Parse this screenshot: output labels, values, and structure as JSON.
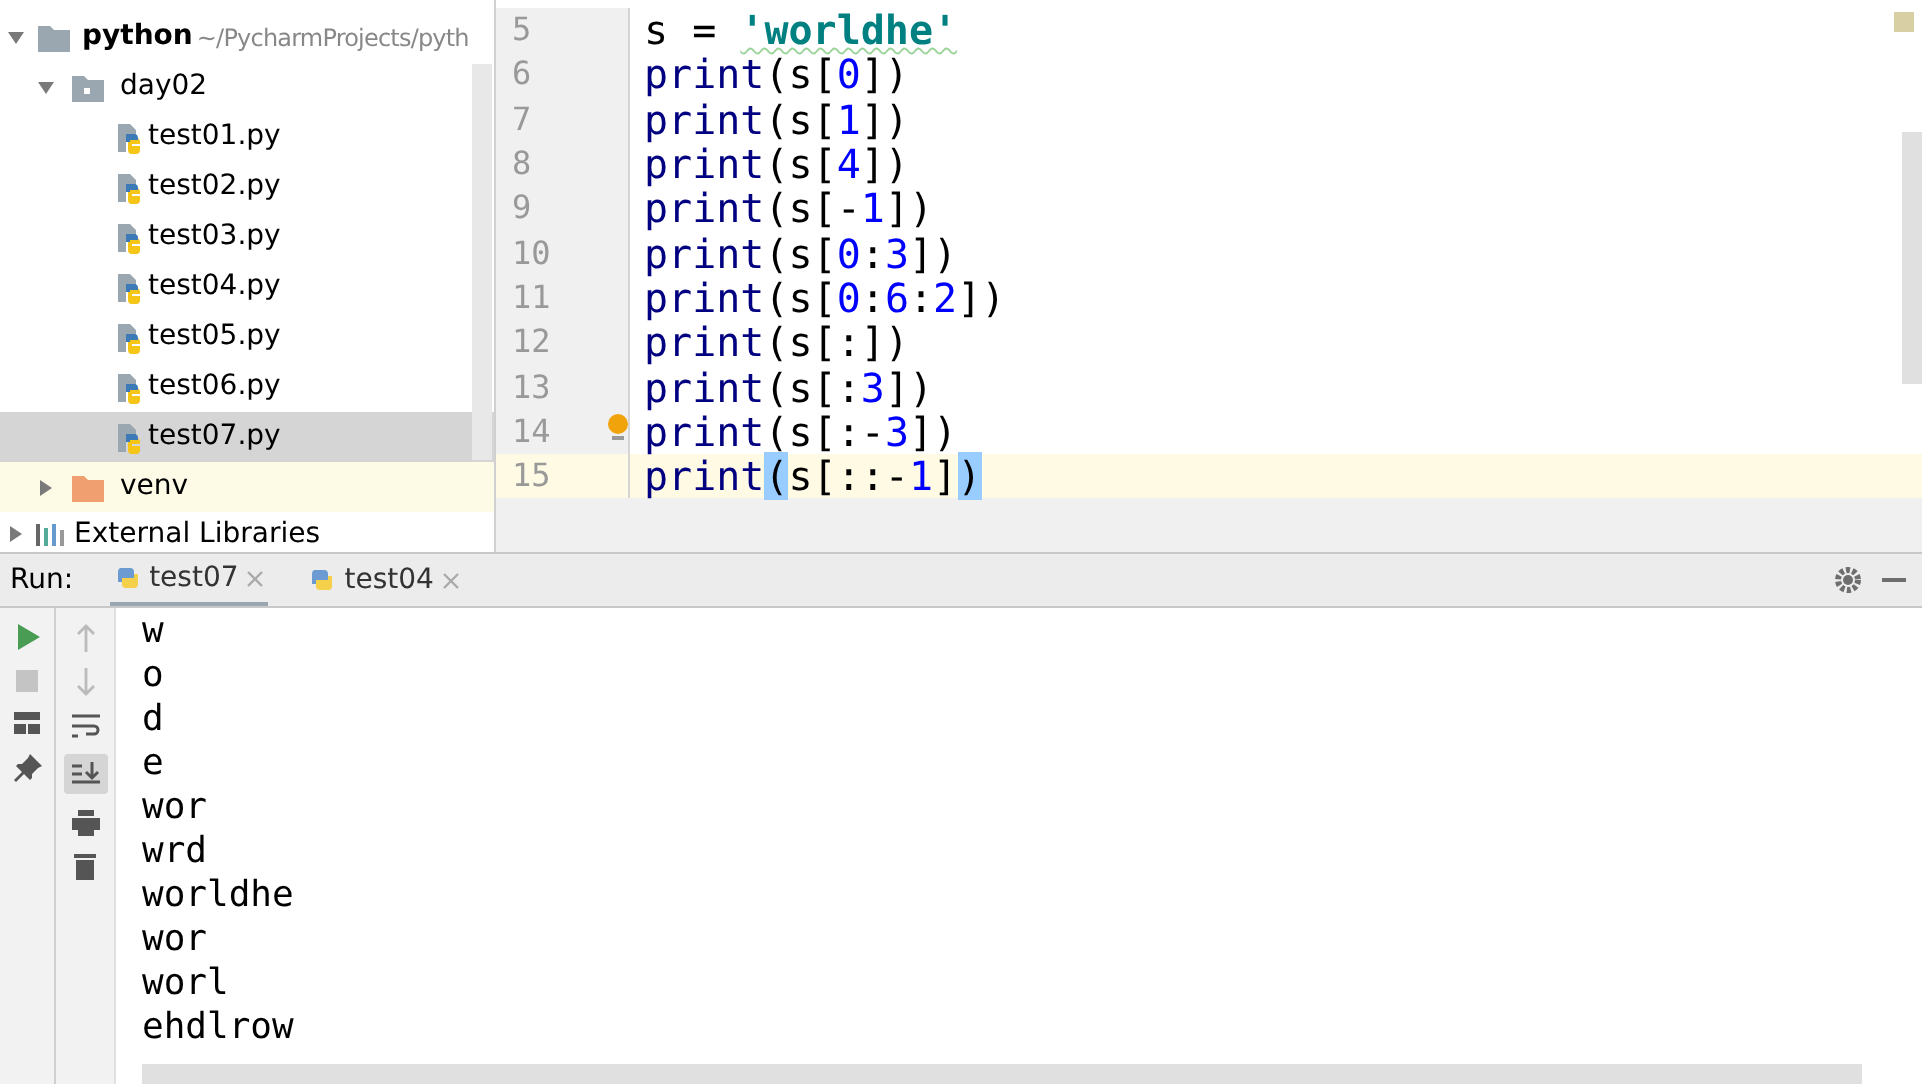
{
  "project_tree": {
    "root": {
      "name": "python",
      "path": "~/PycharmProjects/pyth",
      "expanded": true,
      "children": [
        {
          "name": "day02",
          "kind": "folder",
          "expanded": true,
          "selected": false,
          "children": [
            {
              "name": "test01.py",
              "kind": "python",
              "selected": false
            },
            {
              "name": "test02.py",
              "kind": "python",
              "selected": false
            },
            {
              "name": "test03.py",
              "kind": "python",
              "selected": false
            },
            {
              "name": "test04.py",
              "kind": "python",
              "selected": false
            },
            {
              "name": "test05.py",
              "kind": "python",
              "selected": false
            },
            {
              "name": "test06.py",
              "kind": "python",
              "selected": false
            },
            {
              "name": "test07.py",
              "kind": "python",
              "selected": true
            }
          ]
        },
        {
          "name": "venv",
          "kind": "venv",
          "expanded": false,
          "selected": false
        }
      ]
    },
    "external": {
      "name": "External Libraries",
      "expanded": false
    }
  },
  "editor": {
    "lines": [
      {
        "number": "5",
        "current": false,
        "tokens": [
          {
            "t": "s = ",
            "kind": "plain"
          },
          {
            "t": "'worldhe'",
            "kind": "string"
          }
        ]
      },
      {
        "number": "6",
        "current": false,
        "tokens": [
          {
            "t": "print",
            "kind": "builtin"
          },
          {
            "t": "(s[",
            "kind": "plain"
          },
          {
            "t": "0",
            "kind": "number"
          },
          {
            "t": "])",
            "kind": "plain"
          }
        ]
      },
      {
        "number": "7",
        "current": false,
        "tokens": [
          {
            "t": "print",
            "kind": "builtin"
          },
          {
            "t": "(s[",
            "kind": "plain"
          },
          {
            "t": "1",
            "kind": "number"
          },
          {
            "t": "])",
            "kind": "plain"
          }
        ]
      },
      {
        "number": "8",
        "current": false,
        "tokens": [
          {
            "t": "print",
            "kind": "builtin"
          },
          {
            "t": "(s[",
            "kind": "plain"
          },
          {
            "t": "4",
            "kind": "number"
          },
          {
            "t": "])",
            "kind": "plain"
          }
        ]
      },
      {
        "number": "9",
        "current": false,
        "tokens": [
          {
            "t": "print",
            "kind": "builtin"
          },
          {
            "t": "(s[-",
            "kind": "plain"
          },
          {
            "t": "1",
            "kind": "number"
          },
          {
            "t": "])",
            "kind": "plain"
          }
        ]
      },
      {
        "number": "10",
        "current": false,
        "tokens": [
          {
            "t": "print",
            "kind": "builtin"
          },
          {
            "t": "(s[",
            "kind": "plain"
          },
          {
            "t": "0",
            "kind": "number"
          },
          {
            "t": ":",
            "kind": "plain"
          },
          {
            "t": "3",
            "kind": "number"
          },
          {
            "t": "])",
            "kind": "plain"
          }
        ]
      },
      {
        "number": "11",
        "current": false,
        "tokens": [
          {
            "t": "print",
            "kind": "builtin"
          },
          {
            "t": "(s[",
            "kind": "plain"
          },
          {
            "t": "0",
            "kind": "number"
          },
          {
            "t": ":",
            "kind": "plain"
          },
          {
            "t": "6",
            "kind": "number"
          },
          {
            "t": ":",
            "kind": "plain"
          },
          {
            "t": "2",
            "kind": "number"
          },
          {
            "t": "])",
            "kind": "plain"
          }
        ]
      },
      {
        "number": "12",
        "current": false,
        "tokens": [
          {
            "t": "print",
            "kind": "builtin"
          },
          {
            "t": "(s[:])",
            "kind": "plain"
          }
        ]
      },
      {
        "number": "13",
        "current": false,
        "tokens": [
          {
            "t": "print",
            "kind": "builtin"
          },
          {
            "t": "(s[:",
            "kind": "plain"
          },
          {
            "t": "3",
            "kind": "number"
          },
          {
            "t": "])",
            "kind": "plain"
          }
        ]
      },
      {
        "number": "14",
        "current": false,
        "tokens": [
          {
            "t": "print",
            "kind": "builtin"
          },
          {
            "t": "(s[:-",
            "kind": "plain"
          },
          {
            "t": "3",
            "kind": "number"
          },
          {
            "t": "])",
            "kind": "plain"
          }
        ]
      },
      {
        "number": "15",
        "current": true,
        "tokens": [
          {
            "t": "print",
            "kind": "builtin"
          },
          {
            "t": "(",
            "kind": "match"
          },
          {
            "t": "s[::-",
            "kind": "plain"
          },
          {
            "t": "1",
            "kind": "number"
          },
          {
            "t": "]",
            "kind": "plain"
          },
          {
            "t": ")",
            "kind": "match"
          }
        ]
      }
    ]
  },
  "run_panel": {
    "label": "Run:",
    "tabs": [
      {
        "label": "test07",
        "selected": true
      },
      {
        "label": "test04",
        "selected": false
      }
    ],
    "output": [
      "w",
      "o",
      "d",
      "e",
      "wor",
      "wrd",
      "worldhe",
      "wor",
      "worl",
      "ehdlrow"
    ]
  }
}
